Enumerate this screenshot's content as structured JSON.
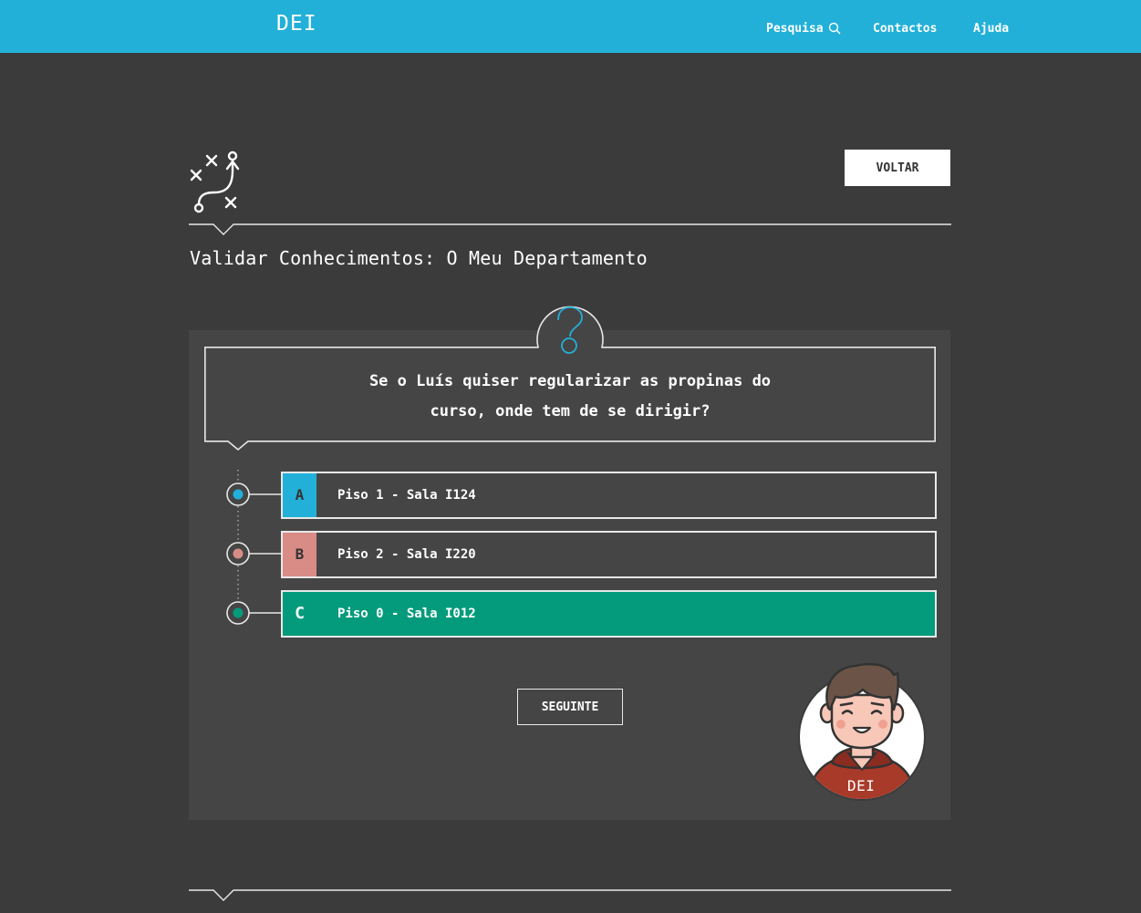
{
  "header": {
    "brand": "DEI",
    "nav": [
      {
        "label": "Pesquisa",
        "icon": "search-icon"
      },
      {
        "label": "Contactos"
      },
      {
        "label": "Ajuda"
      }
    ],
    "accent_color": "#22b0d8"
  },
  "page": {
    "back_label": "VOLTAR",
    "title": "Validar Conhecimentos: O Meu Departamento",
    "header_icon": "game-strategy-icon"
  },
  "quiz": {
    "question_icon": "question-mark-icon",
    "question_lines": [
      "Se o Luís quiser regularizar as propinas do",
      "curso, onde tem de se dirigir?"
    ],
    "options": [
      {
        "letter": "A",
        "text": "Piso 1 - Sala I124",
        "color": "#22b0d8"
      },
      {
        "letter": "B",
        "text": "Piso 2 - Sala I220",
        "color": "#d98c86"
      },
      {
        "letter": "C",
        "text": "Piso 0 - Sala I012",
        "color": "#039b7b",
        "selected": true
      }
    ],
    "next_label": "SEGUINTE",
    "mascot_label": "DEI"
  }
}
